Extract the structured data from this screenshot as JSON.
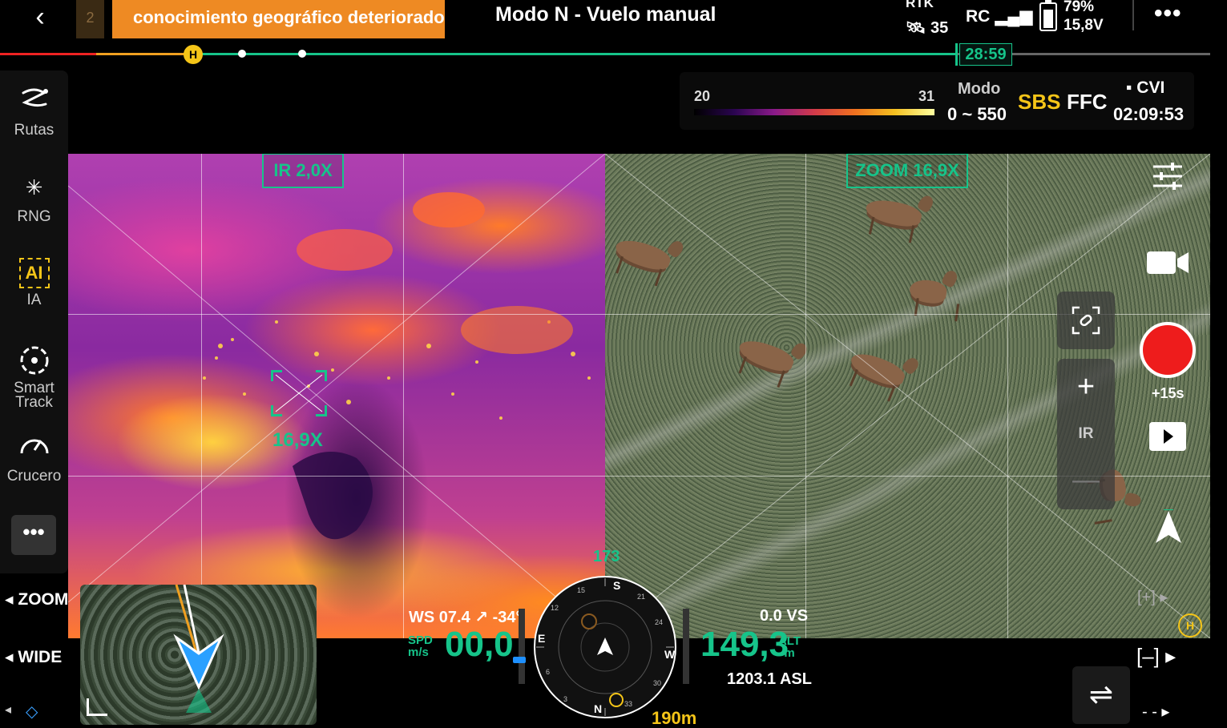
{
  "topbar": {
    "back_icon": "chevron-left-icon",
    "warning_count": "2",
    "warning_text": "conocimiento geográfico deteriorado",
    "mode_title": "Modo N - Vuelo manual",
    "rtk_label": "RTK",
    "rtk_value": "35",
    "rc_label": "RC",
    "battery_percent": "79%",
    "battery_voltage": "15,8V",
    "more_label": "•••"
  },
  "timeline": {
    "home_marker": "H",
    "timer": "28:59",
    "progress_fraction": 0.79
  },
  "thermal": {
    "palette_min": "20",
    "palette_max": "31",
    "modo_label": "Modo",
    "modo_range": "0 ~ 550",
    "sbs_label": "SBS",
    "ffc_label": "FFC",
    "cvi_label": "CVI",
    "record_time": "02:09:53"
  },
  "ir_view": {
    "label": "IR  2,0X",
    "focus_zoom": "16,9X"
  },
  "zoom_view": {
    "label": "ZOOM  16,9X"
  },
  "sidebar": {
    "items": [
      {
        "label": "Rutas",
        "icon": "route-icon"
      },
      {
        "label": "RNG",
        "icon": "rng-icon"
      },
      {
        "label": "IA",
        "icon": "ai-icon"
      },
      {
        "label": "Smart Track",
        "icon": "smart-track-icon"
      },
      {
        "label": "Crucero",
        "icon": "cruise-gauge-icon"
      }
    ],
    "more_label": "•••"
  },
  "lens": {
    "zoom_label": "◂ ZOOM",
    "wide_label": "◂ WIDE",
    "nav_left": "◂"
  },
  "telemetry": {
    "ws": "WS 07.4 ↗ -34°",
    "spd_label": "SPD m/s",
    "spd_value": "00,0",
    "alt_value": "149,3",
    "alt_label": "ALT m",
    "vs": "0.0 VS",
    "asl": "1203.1 ASL",
    "heading": "173",
    "distance": "190m",
    "compass": {
      "n": "N",
      "e": "E",
      "s": "S",
      "w": "W",
      "ticks": [
        "15",
        "21",
        "24",
        "30",
        "33",
        "3",
        "6",
        "12"
      ]
    }
  },
  "right_controls": {
    "rec_plus": "+15s",
    "zoom_plus": "+",
    "zoom_ir": "IR",
    "zoom_minus": "—",
    "frame_plus": "[+] ▸",
    "frame_minus": "[–] ▸",
    "swap": "⇌",
    "dash_ctrl": "- - ▸",
    "home_corner": "H"
  },
  "colors": {
    "accent_green": "#16c48a",
    "warning_orange": "#ee8a23",
    "home_yellow": "#f5c518",
    "record_red": "#ee1c1c"
  }
}
